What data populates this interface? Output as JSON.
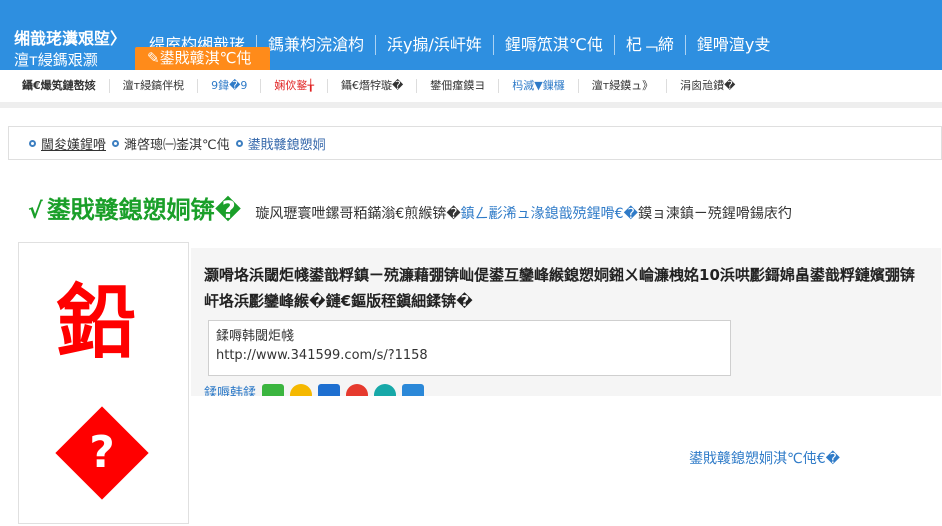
{
  "header": {
    "logo_line1": "缃戠珯瀵艰埅〉",
    "logo_line2": "澶т綅鎷艰灏",
    "nav": [
      "缇庢枃缃戠珯",
      "鎷兼枃浣滄枃",
      "浜у搧/浜屽姩",
      "鍟嗕笟淇℃伅",
      "杞﹁締",
      "鍟嗗澶у叏"
    ],
    "active_tab": "鍙戝竷淇℃伅"
  },
  "subnav": [
    "鑷€熶笂鏈嶅姟",
    "澶т綅鎬伴棿",
    "9鍏�9",
    "娴佽鐜╁",
    "鑷€熸牸璇�",
    "鐢佃瘽鏌ヨ",
    "杩滅▼鏁欏",
    "澶т綅鏌ュ》",
    "涓囪兘鐨�"
  ],
  "breadcrumb": [
    "閫夋嫨鍟嗗",
    "濉啓璁㈠崟淇℃伅",
    "鍙戝竷鎴愬姛"
  ],
  "title": {
    "check": "√",
    "main": "鍙戝竷鎴愬姛锛�",
    "desc_before": "璇风瓑寰呭鏍哥粨鏋滃€煎緱锛�",
    "desc_highlight": "鎮ㄥ彲浠ュ湪鎴戠殑鍟嗗€�",
    "desc_after": "鏌ョ湅鎮ㄧ殑鍟嗗鍚庡彴"
  },
  "left_char": "鉛",
  "left_question": "?",
  "content": {
    "text": "灏嗗垎浜閾炬帴鍙戠粰鎮ㄧ殑濂藉弸锛屾偍鍙互鑾峰緱鎴愬姛鎺ㄨ崘濂栧姳10浜哄彲鎶婂畠鍙戠粰鏈嬪弸锛屽垎浜彲鑾峰緱�鏈€鏂版秷鎭細鍒锛�",
    "url_label": "鍒嗕韩閾炬帴",
    "url": "http://www.341599.com/s/?1158",
    "share_label": "鍒嗕韩鍒"
  },
  "bottom_link": "鍙戝竷鎴愬姛淇℃伅€�"
}
